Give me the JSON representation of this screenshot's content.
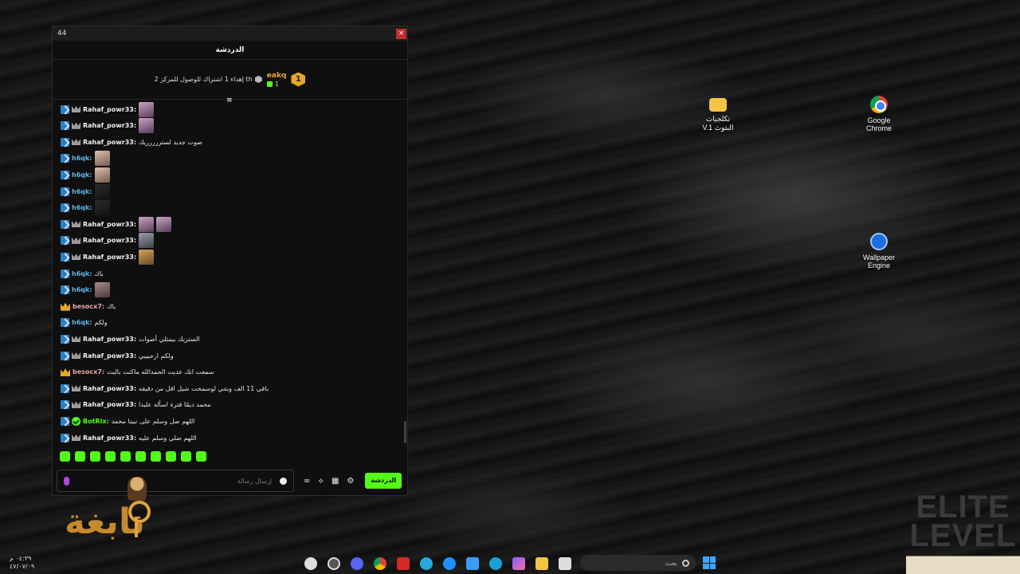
{
  "window": {
    "title": "44",
    "close_label": "×"
  },
  "chat": {
    "header": "الدردشة",
    "pinned": {
      "rank": "1",
      "user": "eakq",
      "count": "1",
      "text": "إهداء 1 اشتراك للوصول للمركز 2 th"
    },
    "messages": [
      {
        "badges": [
          "kick",
          "crown-sm"
        ],
        "user": "Rahaf_powr33:",
        "user_color": "#f1f1f1",
        "text": "",
        "emotes": [
          "e1"
        ]
      },
      {
        "badges": [
          "kick",
          "crown-sm"
        ],
        "user": "Rahaf_powr33:",
        "user_color": "#f1f1f1",
        "text": "",
        "emotes": [
          "e1"
        ]
      },
      {
        "badges": [
          "kick",
          "crown-sm"
        ],
        "user": "Rahaf_powr33:",
        "user_color": "#f1f1f1",
        "text": "صوت جديد لستررررريك",
        "emotes": []
      },
      {
        "badges": [
          "kick"
        ],
        "user": "h6qk:",
        "user_color": "#5fb6e8",
        "text": "",
        "emotes": [
          "e2"
        ]
      },
      {
        "badges": [
          "kick"
        ],
        "user": "h6qk:",
        "user_color": "#5fb6e8",
        "text": "",
        "emotes": [
          "e2"
        ]
      },
      {
        "badges": [
          "kick"
        ],
        "user": "h6qk:",
        "user_color": "#5fb6e8",
        "text": "",
        "emotes": [
          "e3"
        ]
      },
      {
        "badges": [
          "kick"
        ],
        "user": "h6qk:",
        "user_color": "#5fb6e8",
        "text": "",
        "emotes": [
          "e3"
        ]
      },
      {
        "badges": [
          "kick",
          "crown-sm"
        ],
        "user": "Rahaf_powr33:",
        "user_color": "#f1f1f1",
        "text": "",
        "emotes": [
          "e1",
          "e1"
        ]
      },
      {
        "badges": [
          "kick",
          "crown-sm"
        ],
        "user": "Rahaf_powr33:",
        "user_color": "#f1f1f1",
        "text": "",
        "emotes": [
          "e4"
        ]
      },
      {
        "badges": [
          "kick",
          "crown-sm"
        ],
        "user": "Rahaf_powr33:",
        "user_color": "#f1f1f1",
        "text": "",
        "emotes": [
          "e5"
        ]
      },
      {
        "badges": [
          "kick"
        ],
        "user": "h6qk:",
        "user_color": "#5fb6e8",
        "text": "باك",
        "emotes": []
      },
      {
        "badges": [
          "kick"
        ],
        "user": "h6qk:",
        "user_color": "#5fb6e8",
        "text": "",
        "emotes": [
          "e6"
        ]
      },
      {
        "badges": [
          "crown-gold"
        ],
        "user": "besocx7:",
        "user_color": "#e9a3a8",
        "text": "باك",
        "emotes": []
      },
      {
        "badges": [
          "kick"
        ],
        "user": "h6qk:",
        "user_color": "#5fb6e8",
        "text": "ولكم",
        "emotes": []
      },
      {
        "badges": [
          "kick",
          "crown-sm"
        ],
        "user": "Rahaf_powr33:",
        "user_color": "#f1f1f1",
        "text": "الستريك بيمثلي أصوات",
        "emotes": []
      },
      {
        "badges": [
          "kick",
          "crown-sm"
        ],
        "user": "Rahaf_powr33:",
        "user_color": "#f1f1f1",
        "text": "ولكم ارحبيبي",
        "emotes": []
      },
      {
        "badges": [
          "crown-gold"
        ],
        "user": "besocx7:",
        "user_color": "#e9a3a8",
        "text": "سمعت انك عديت الحمدالله ماكنت بالبث",
        "emotes": []
      },
      {
        "badges": [
          "kick",
          "crown-sm"
        ],
        "user": "Rahaf_powr33:",
        "user_color": "#f1f1f1",
        "text": "باقي 11 الف وبتني لوسمحت شيل اقل من دقيقه",
        "emotes": []
      },
      {
        "badges": [
          "kick",
          "crown-sm"
        ],
        "user": "Rahaf_powr33:",
        "user_color": "#f1f1f1",
        "text": "محمد ديمًا فترة اسأله عليدا",
        "emotes": []
      },
      {
        "badges": [
          "kick",
          "bot"
        ],
        "user": "BotRix:",
        "user_color": "#53fc18",
        "text": "اللهم صل وسلم على نبينا محمد",
        "emotes": []
      },
      {
        "badges": [
          "kick",
          "crown-sm"
        ],
        "user": "Rahaf_powr33:",
        "user_color": "#f1f1f1",
        "text": "اللهم صلي وسلم عليه",
        "emotes": []
      }
    ],
    "input_placeholder": "إرسال رسالة",
    "send_label": "الدردشة",
    "tools": [
      "∞",
      "⟡",
      "▦",
      "⚙"
    ]
  },
  "desktop": {
    "icons": [
      {
        "name": "folder",
        "label_line1": "تكلجيات",
        "label_line2": "V.1 البثوث"
      },
      {
        "name": "chrome",
        "label_line1": "Google",
        "label_line2": "Chrome"
      },
      {
        "name": "wallpaper-engine",
        "label_line1": "Wallpaper",
        "label_line2": "Engine"
      }
    ]
  },
  "overlay": {
    "left_logo": "نابغة",
    "right_logo_line1": "ELITE",
    "right_logo_line2": "LEVEL"
  },
  "taskbar": {
    "search_placeholder": "بحث",
    "time": "٠٤:٣٩ م",
    "date": "٤٧/٠٧/٠٩"
  },
  "colors": {
    "accent": "#53fc18",
    "gold": "#e4a82a"
  }
}
